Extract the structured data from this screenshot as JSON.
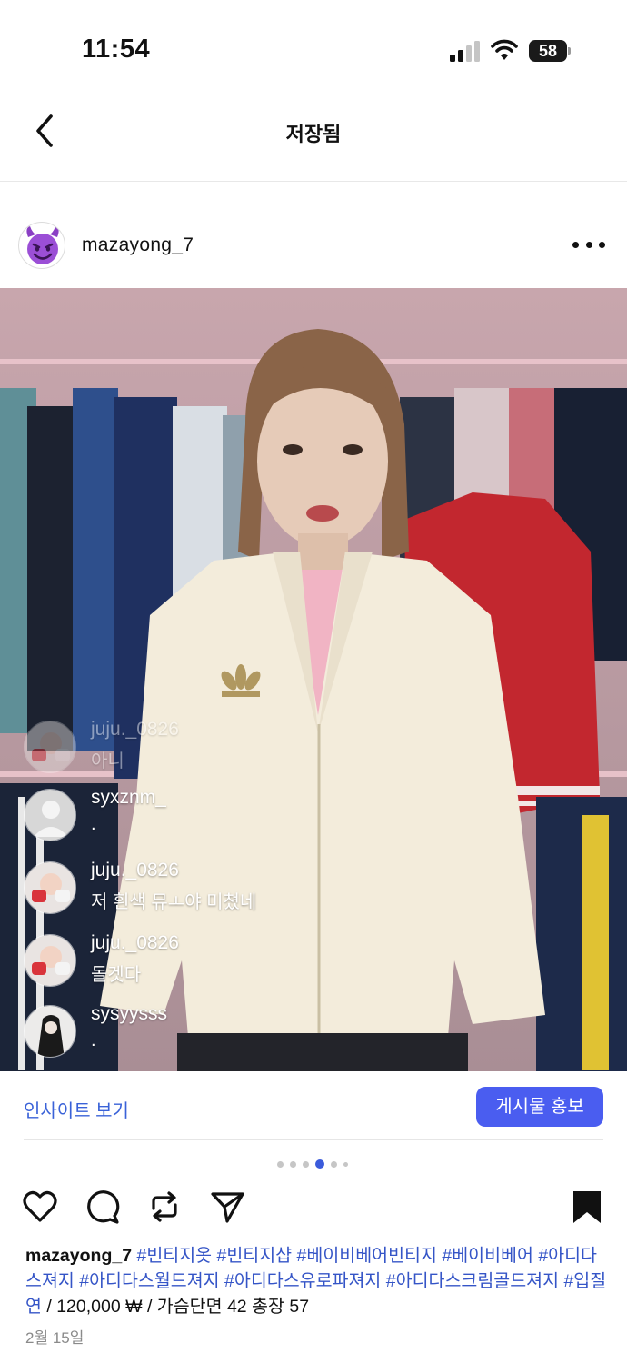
{
  "status_bar": {
    "time": "11:54",
    "battery": "58"
  },
  "header": {
    "title": "저장됨",
    "back_icon": "chevron-left-icon"
  },
  "post": {
    "username": "mazayong_7",
    "avatar_icon": "smiling-devil-emoji-icon",
    "more_icon": "more-horizontal-icon"
  },
  "live_comments": [
    {
      "user": "juju._0826",
      "text": "아니"
    },
    {
      "user": "syxznm_",
      "text": "."
    },
    {
      "user": "juju._0826",
      "text": "저 흰색 뮤ㅗ야 미쳤네"
    },
    {
      "user": "juju._0826",
      "text": "돌겟다"
    },
    {
      "user": "sysyysss",
      "text": "."
    }
  ],
  "insights": {
    "link_label": "인사이트 보기",
    "promote_label": "게시물 홍보"
  },
  "carousel": {
    "count": 6,
    "active_index": 3
  },
  "actions": {
    "like_icon": "heart-icon",
    "comment_icon": "comment-bubble-icon",
    "repost_icon": "repost-icon",
    "share_icon": "send-icon",
    "save_icon": "bookmark-filled-icon"
  },
  "caption": {
    "user": "mazayong_7",
    "tags": [
      "#빈티지옷",
      "#빈티지샵",
      "#베이비베어빈티지",
      "#베이비베어",
      "#아디다스져지",
      "#아디다스월드져지",
      "#아디다스유로파져지",
      "#아디다스크림골드져지",
      "#입질연"
    ],
    "text": "/ 120,000 ₩ / 가슴단면 42 총장 57"
  },
  "date": "2월 15일",
  "colors": {
    "accent": "#4a5df0",
    "link": "#3a62d8",
    "hashtag": "#3555c7"
  }
}
